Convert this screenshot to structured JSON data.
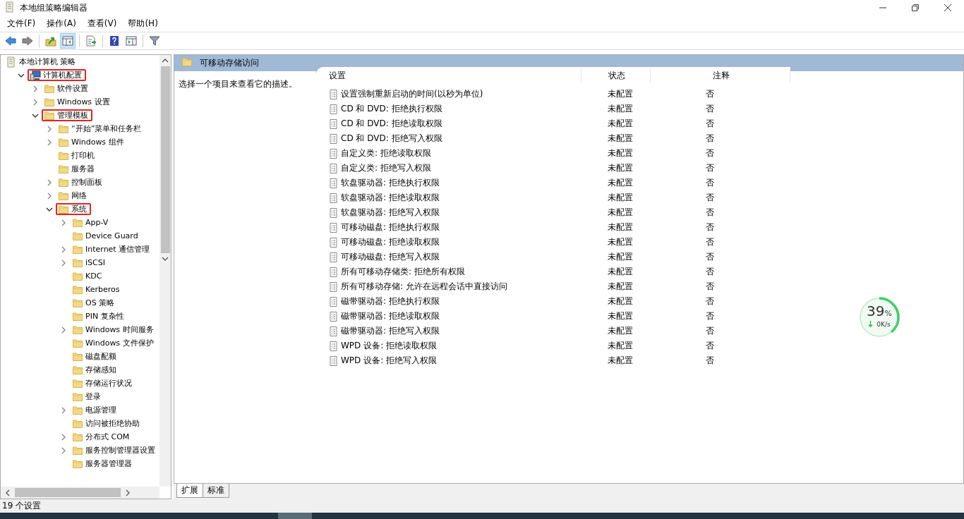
{
  "window": {
    "title": "本地组策略编辑器"
  },
  "menu": [
    "文件(F)",
    "操作(A)",
    "查看(V)",
    "帮助(H)"
  ],
  "toolbar": [
    {
      "kind": "back",
      "pressed": false
    },
    {
      "kind": "forward",
      "pressed": false
    },
    {
      "kind": "sep"
    },
    {
      "kind": "up",
      "pressed": false
    },
    {
      "kind": "pane",
      "pressed": true
    },
    {
      "kind": "sep"
    },
    {
      "kind": "export",
      "pressed": false
    },
    {
      "kind": "sep"
    },
    {
      "kind": "help",
      "pressed": false
    },
    {
      "kind": "pane2",
      "pressed": false
    },
    {
      "kind": "sep"
    },
    {
      "kind": "filter",
      "pressed": false
    }
  ],
  "tree": [
    {
      "label": "本地计算机 策略",
      "kind": "root",
      "annotated": false,
      "children": [
        {
          "label": "计算机配置",
          "kind": "computer",
          "expanded": true,
          "annotated": true,
          "children": [
            {
              "label": "软件设置",
              "kind": "branch",
              "expanded": false,
              "annotated": false
            },
            {
              "label": "Windows 设置",
              "kind": "branch",
              "expanded": false,
              "annotated": false
            },
            {
              "label": "管理模板",
              "kind": "branch",
              "expanded": true,
              "annotated": true,
              "children": [
                {
                  "label": "“开始”菜单和任务栏",
                  "kind": "branch",
                  "expanded": false,
                  "annotated": false
                },
                {
                  "label": "Windows 组件",
                  "kind": "branch",
                  "expanded": false,
                  "annotated": false
                },
                {
                  "label": "打印机",
                  "kind": "leaf",
                  "annotated": false
                },
                {
                  "label": "服务器",
                  "kind": "leaf",
                  "annotated": false
                },
                {
                  "label": "控制面板",
                  "kind": "branch",
                  "expanded": false,
                  "annotated": false
                },
                {
                  "label": "网络",
                  "kind": "branch",
                  "expanded": false,
                  "annotated": false
                },
                {
                  "label": "系统",
                  "kind": "branch",
                  "expanded": true,
                  "annotated": true,
                  "children": [
                    {
                      "label": "App-V",
                      "kind": "branch",
                      "expanded": false,
                      "annotated": false
                    },
                    {
                      "label": "Device Guard",
                      "kind": "leaf",
                      "annotated": false
                    },
                    {
                      "label": "Internet 通信管理",
                      "kind": "branch",
                      "expanded": false,
                      "annotated": false
                    },
                    {
                      "label": "iSCSI",
                      "kind": "branch",
                      "expanded": false,
                      "annotated": false
                    },
                    {
                      "label": "KDC",
                      "kind": "leaf",
                      "annotated": false
                    },
                    {
                      "label": "Kerberos",
                      "kind": "leaf",
                      "annotated": false
                    },
                    {
                      "label": "OS 策略",
                      "kind": "leaf",
                      "annotated": false
                    },
                    {
                      "label": "PIN 复杂性",
                      "kind": "leaf",
                      "annotated": false
                    },
                    {
                      "label": "Windows 时间服务",
                      "kind": "branch",
                      "expanded": false,
                      "annotated": false
                    },
                    {
                      "label": "Windows 文件保护",
                      "kind": "leaf",
                      "annotated": false
                    },
                    {
                      "label": "磁盘配额",
                      "kind": "leaf",
                      "annotated": false
                    },
                    {
                      "label": "存储感知",
                      "kind": "leaf",
                      "annotated": false
                    },
                    {
                      "label": "存储运行状况",
                      "kind": "leaf",
                      "annotated": false
                    },
                    {
                      "label": "登录",
                      "kind": "leaf",
                      "annotated": false
                    },
                    {
                      "label": "电源管理",
                      "kind": "branch",
                      "expanded": false,
                      "annotated": false
                    },
                    {
                      "label": "访问被拒绝协助",
                      "kind": "leaf",
                      "annotated": false
                    },
                    {
                      "label": "分布式 COM",
                      "kind": "branch",
                      "expanded": false,
                      "annotated": false
                    },
                    {
                      "label": "服务控制管理器设置",
                      "kind": "branch",
                      "expanded": false,
                      "annotated": false
                    },
                    {
                      "label": "服务器管理器",
                      "kind": "leaf",
                      "annotated": false
                    }
                  ]
                }
              ]
            }
          ]
        }
      ]
    }
  ],
  "panel": {
    "title": "可移动存储访问",
    "description": "选择一个项目来查看它的描述。"
  },
  "table": {
    "columns": [
      "设置",
      "状态",
      "注释"
    ],
    "rows": [
      [
        "设置强制重新启动的时间(以秒为单位)",
        "未配置",
        "否"
      ],
      [
        "CD 和 DVD: 拒绝执行权限",
        "未配置",
        "否"
      ],
      [
        "CD 和 DVD: 拒绝读取权限",
        "未配置",
        "否"
      ],
      [
        "CD 和 DVD: 拒绝写入权限",
        "未配置",
        "否"
      ],
      [
        "自定义类: 拒绝读取权限",
        "未配置",
        "否"
      ],
      [
        "自定义类: 拒绝写入权限",
        "未配置",
        "否"
      ],
      [
        "软盘驱动器: 拒绝执行权限",
        "未配置",
        "否"
      ],
      [
        "软盘驱动器: 拒绝读取权限",
        "未配置",
        "否"
      ],
      [
        "软盘驱动器: 拒绝写入权限",
        "未配置",
        "否"
      ],
      [
        "可移动磁盘: 拒绝执行权限",
        "未配置",
        "否"
      ],
      [
        "可移动磁盘: 拒绝读取权限",
        "未配置",
        "否"
      ],
      [
        "可移动磁盘: 拒绝写入权限",
        "未配置",
        "否"
      ],
      [
        "所有可移动存储类: 拒绝所有权限",
        "未配置",
        "否"
      ],
      [
        "所有可移动存储: 允许在远程会话中直接访问",
        "未配置",
        "否"
      ],
      [
        "磁带驱动器: 拒绝执行权限",
        "未配置",
        "否"
      ],
      [
        "磁带驱动器: 拒绝读取权限",
        "未配置",
        "否"
      ],
      [
        "磁带驱动器: 拒绝写入权限",
        "未配置",
        "否"
      ],
      [
        "WPD 设备: 拒绝读取权限",
        "未配置",
        "否"
      ],
      [
        "WPD 设备: 拒绝写入权限",
        "未配置",
        "否"
      ]
    ]
  },
  "tabs": [
    {
      "label": "扩展",
      "selected": true
    },
    {
      "label": "标准",
      "selected": false
    }
  ],
  "gauge": {
    "percent": "39",
    "unit": "%",
    "speed": "0K/s",
    "level": 0.39
  },
  "status_bar": "19 个设置"
}
